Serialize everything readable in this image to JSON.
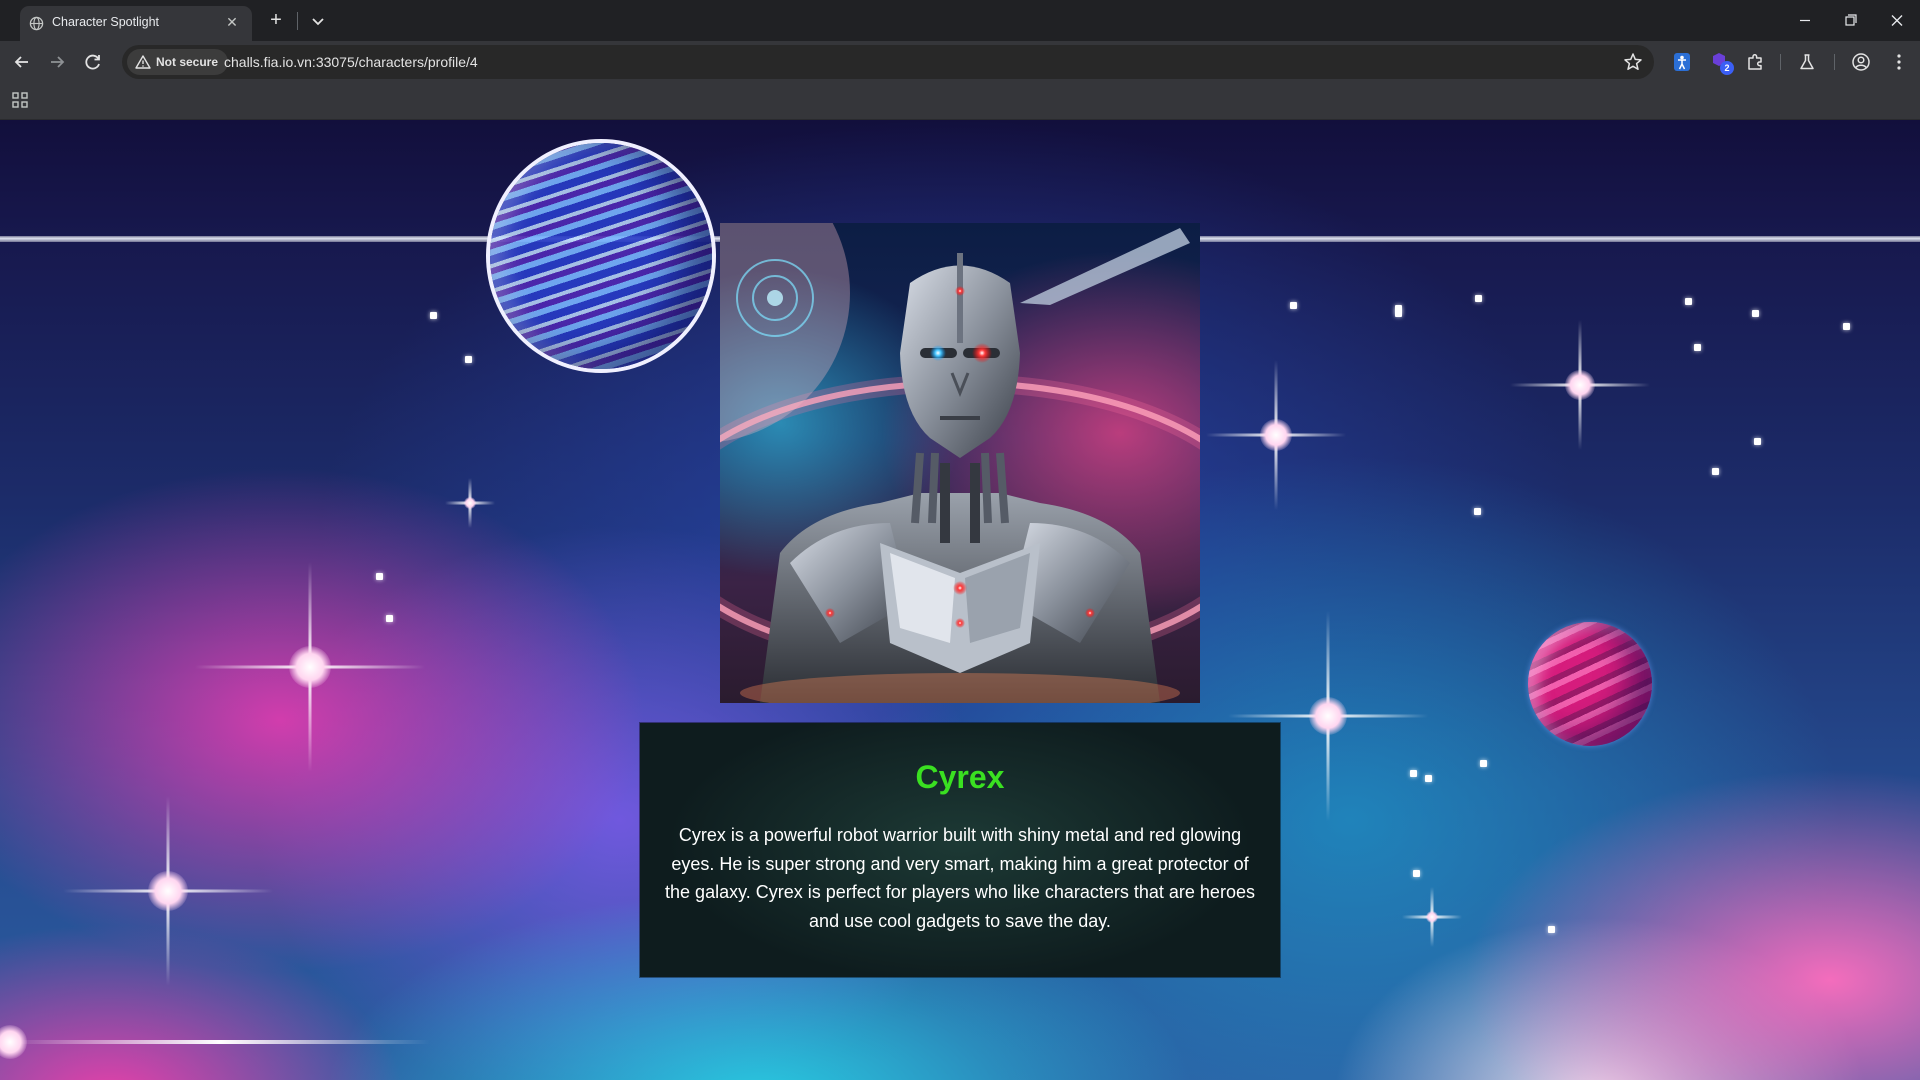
{
  "browser": {
    "tab": {
      "title": "Character Spotlight",
      "favicon": "globe-icon"
    },
    "omnibox": {
      "security_label": "Not secure",
      "url": "challs.fia.io.vn:33075/characters/profile/4"
    },
    "extension_badge": "2"
  },
  "page": {
    "character": {
      "name": "Cyrex",
      "description": "Cyrex is a powerful robot warrior built with shiny metal and red glowing eyes. He is super strong and very smart, making him a great protector of the galaxy. Cyrex is perfect for players who like characters that are heroes and use cool gadgets to save the day.",
      "portrait": "robot-warrior-portrait"
    },
    "colors": {
      "name": "#3ae021",
      "card_background": "#0f1b1d",
      "sky_top": "#120f3c"
    }
  }
}
